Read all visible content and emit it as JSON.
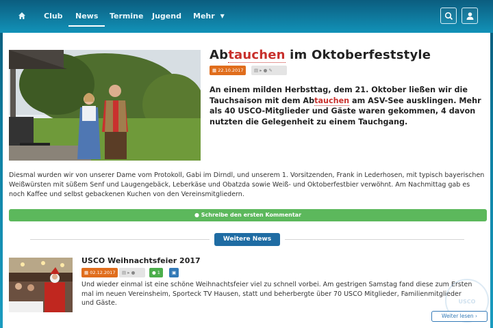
{
  "nav": {
    "items": [
      {
        "label": "Club"
      },
      {
        "label": "News"
      },
      {
        "label": "Termine"
      },
      {
        "label": "Jugend"
      },
      {
        "label": "Mehr"
      }
    ]
  },
  "main_article": {
    "title_prefix": "Ab",
    "title_highlight": "tauchen",
    "title_suffix": " im Oktoberfeststyle",
    "date": "22.10.2017",
    "lead_part1": "An einem milden Herbsttag, dem 21. Oktober ließen wir die Tauchsaison mit dem Ab",
    "lead_highlight": "tauchen",
    "lead_part2": " am ASV-See ausklingen. Mehr als 40 USCO-Mitglieder und Gäste waren gekommen, 4 davon nutzten die Gelegenheit zu einem Tauchgang.",
    "body": "Diesmal wurden wir von unserer Dame vom Protokoll, Gabi im Dirndl, und unserem 1. Vorsitzenden, Frank in Lederhosen, mit typisch bayerischen Weißwürsten mit süßem Senf und Laugengebäck, Leberkäse und Obatzda sowie Weiß- und Oktoberfestbier verwöhnt. Am Nachmittag gab es noch Kaffee und selbst gebackenen Kuchen von den Vereinsmitgliedern.",
    "comment_label": "Schreibe den ersten Kommentar"
  },
  "more_news_label": "Weitere News",
  "second_article": {
    "title": "USCO Weihnachtsfeier 2017",
    "date": "02.12.2017",
    "comments": "1",
    "text": "Und wieder einmal ist eine schöne Weihnachtsfeier viel zu schnell vorbei. Am gestrigen Samstag fand diese zum Ersten mal im neuen Vereinsheim, Sporteck TV Hausen, statt und beherbergte über 70 USCO Mitglieder, Familienmitglieder und Gäste.",
    "read_more": "Weiter lesen"
  },
  "watermark_text": "USCO"
}
